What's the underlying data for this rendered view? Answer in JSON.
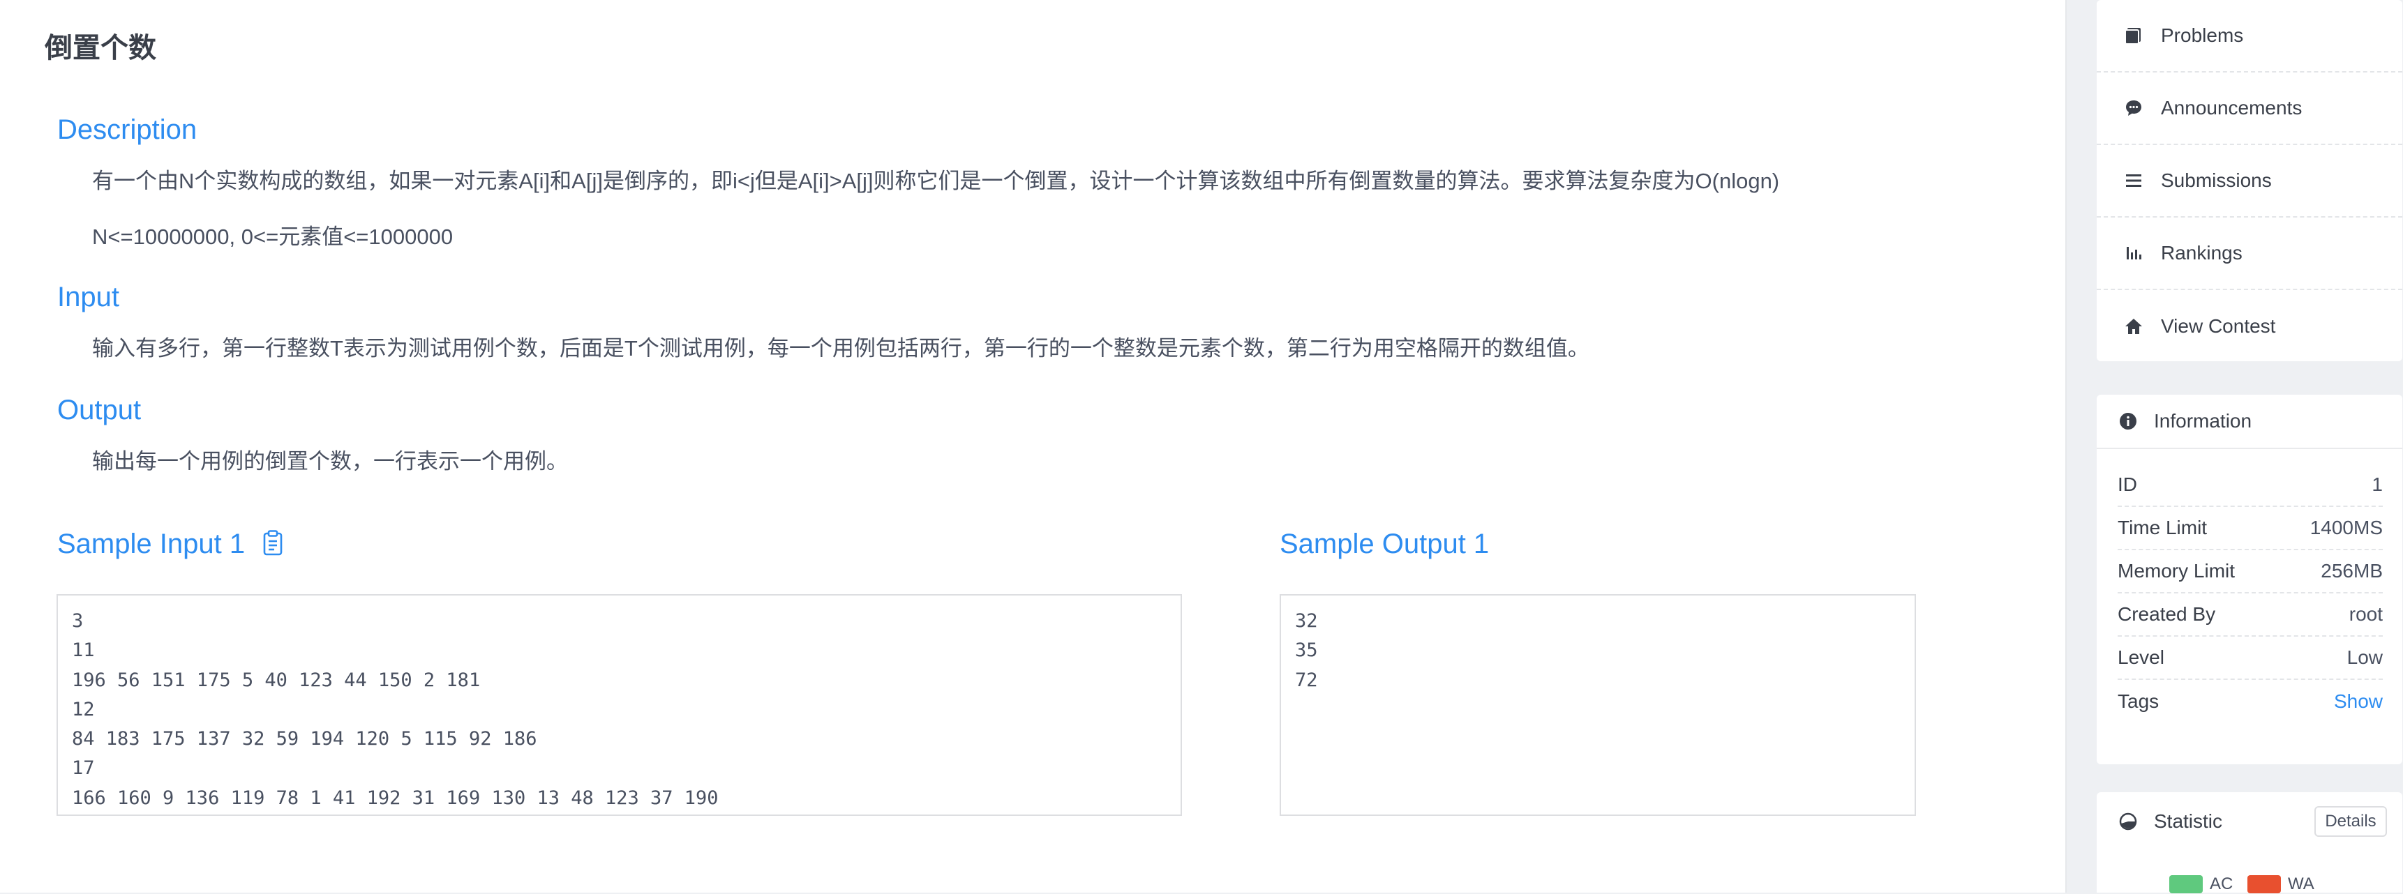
{
  "problem": {
    "title": "倒置个数",
    "description_title": "Description",
    "description_lines": [
      "有一个由N个实数构成的数组，如果一对元素A[i]和A[j]是倒序的，即i<j但是A[i]>A[j]则称它们是一个倒置，设计一个计算该数组中所有倒置数量的算法。要求算法复杂度为O(nlogn)",
      "N<=10000000, 0<=元素值<=1000000"
    ],
    "input_title": "Input",
    "input_text": "输入有多行，第一行整数T表示为测试用例个数，后面是T个测试用例，每一个用例包括两行，第一行的一个整数是元素个数，第二行为用空格隔开的数组值。",
    "output_title": "Output",
    "output_text": "输出每一个用例的倒置个数，一行表示一个用例。",
    "sample_input_title": "Sample Input 1",
    "sample_output_title": "Sample Output 1",
    "sample_input": "3\n11\n196 56 151 175 5 40 123 44 150 2 181\n12\n84 183 175 137 32 59 194 120 5 115 92 186\n17\n166 160 9 136 119 78 1 41 192 31 169 130 13 48 123 37 190",
    "sample_output": "32\n35\n72"
  },
  "nav": {
    "items": [
      {
        "label": "Problems",
        "icon": "book-icon"
      },
      {
        "label": "Announcements",
        "icon": "chat-bubble-icon"
      },
      {
        "label": "Submissions",
        "icon": "list-icon"
      },
      {
        "label": "Rankings",
        "icon": "bar-chart-icon"
      },
      {
        "label": "View Contest",
        "icon": "home-icon"
      }
    ]
  },
  "info": {
    "title": "Information",
    "rows": [
      {
        "label": "ID",
        "value": "1"
      },
      {
        "label": "Time Limit",
        "value": "1400MS"
      },
      {
        "label": "Memory Limit",
        "value": "256MB"
      },
      {
        "label": "Created By",
        "value": "root"
      },
      {
        "label": "Level",
        "value": "Low"
      },
      {
        "label": "Tags",
        "value": "Show"
      }
    ]
  },
  "statistic": {
    "title": "Statistic",
    "details_label": "Details",
    "legend": [
      {
        "label": "AC",
        "color": "#5fc97e"
      },
      {
        "label": "WA",
        "color": "#e8502f"
      }
    ]
  },
  "colors": {
    "accent": "#2d8cf0",
    "text": "#495060"
  }
}
